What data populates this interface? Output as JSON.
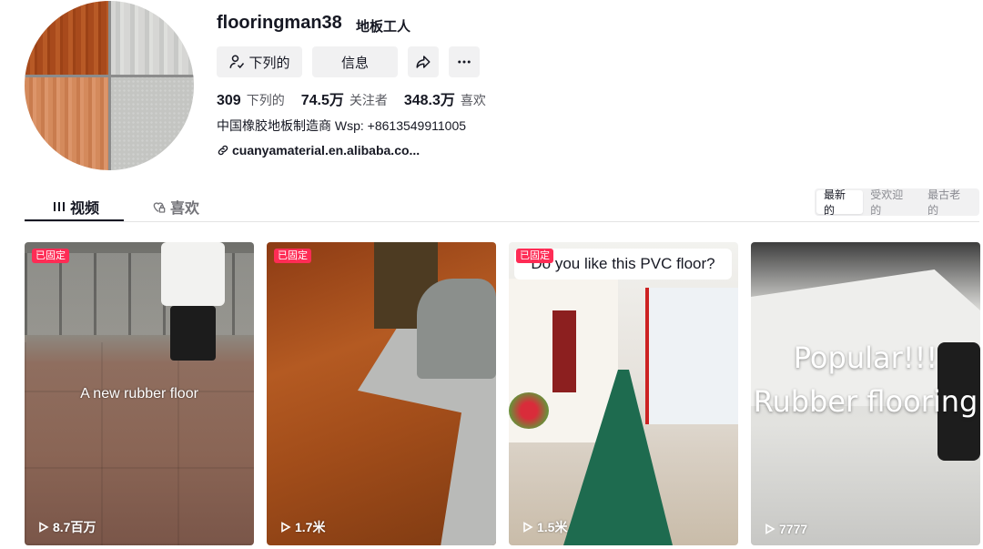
{
  "profile": {
    "username": "flooringman38",
    "nickname": "地板工人",
    "bio": "中国橡胶地板制造商 Wsp: +8613549911005",
    "link": "cuanyamaterial.en.alibaba.co..."
  },
  "actions": {
    "follow_label": "下列的",
    "message_label": "信息",
    "share_icon": "share-icon",
    "more_icon": "more-icon"
  },
  "stats": {
    "following_count": "309",
    "following_label": "下列的",
    "followers_count": "74.5万",
    "followers_label": "关注者",
    "likes_count": "348.3万",
    "likes_label": "喜欢"
  },
  "tabs": [
    {
      "label": "视频",
      "icon": "grid-icon",
      "active": true
    },
    {
      "label": "喜欢",
      "icon": "heart-lock-icon",
      "active": false
    }
  ],
  "sort": {
    "options": [
      "最新的",
      "受欢迎的",
      "最古老的"
    ],
    "selected": "最新的"
  },
  "videos": [
    {
      "pinned_label": "已固定",
      "overlay_text": "A new rubber floor",
      "views": "8.7百万"
    },
    {
      "pinned_label": "已固定",
      "overlay_text": "",
      "views": "1.7米"
    },
    {
      "pinned_label": "已固定",
      "overlay_text": "Do you like this PVC floor?",
      "views": "1.5米"
    },
    {
      "pinned_label": "",
      "overlay_text_line1": "Popular!!!",
      "overlay_text_line2": "Rubber flooring",
      "views": "7777"
    }
  ],
  "colors": {
    "accent_pin": "#fe2c55",
    "text_primary": "#161823",
    "button_bg": "#f1f1f2"
  }
}
